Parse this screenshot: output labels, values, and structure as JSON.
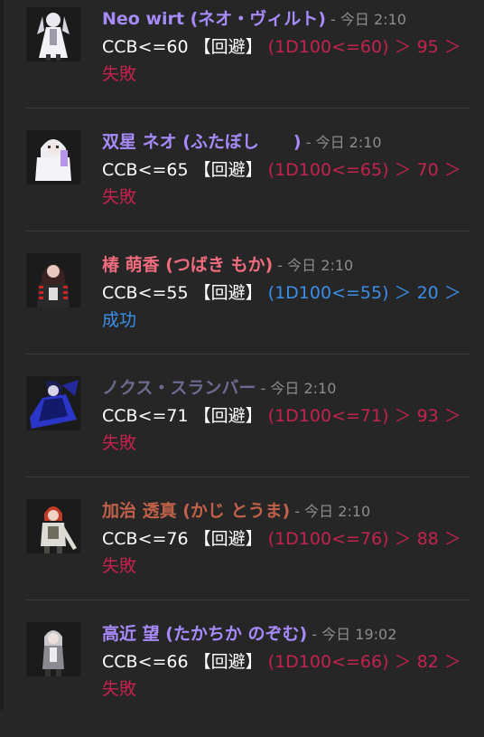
{
  "messages": [
    {
      "name": "Neo wirt (ネオ・ヴィルト)",
      "name_color": "#a78bfa",
      "separator": " - ",
      "time": "今日 2:10",
      "command": "CCB<=60 【回避】 ",
      "result_line1": "(1D100<=60) ＞ 95 ＞",
      "result_line2": "失敗",
      "outcome": "fail",
      "avatar": "white-haired-character-avatar"
    },
    {
      "name": "双星 ネオ (ふたぼし　　)",
      "name_color": "#a78bfa",
      "separator": " - ",
      "time": "今日 2:10",
      "command": "CCB<=65 【回避】 ",
      "result_line1": "(1D100<=65) ＞ 70 ＞",
      "result_line2": "失敗",
      "outcome": "fail",
      "avatar": "hooded-white-character-avatar"
    },
    {
      "name": "椿 萌香 (つばき もか)",
      "name_color": "#f06b7d",
      "separator": " - ",
      "time": "今日 2:10",
      "command": "CCB<=55 【回避】 ",
      "result_line1": "(1D100<=55) ＞ 20 ＞",
      "result_line2": "成功",
      "outcome": "success",
      "avatar": "dark-haired-striped-character-avatar"
    },
    {
      "name": "ノクス・スランバー",
      "name_color": "#6b6b8f",
      "separator": " - ",
      "time": "今日 2:10",
      "command": "CCB<=71 【回避】 ",
      "result_line1": "(1D100<=71) ＞ 93 ＞",
      "result_line2": "失敗",
      "outcome": "fail",
      "avatar": "blue-cloaked-character-avatar"
    },
    {
      "name": "加治 透真 (かじ とうま)",
      "name_color": "#c0614a",
      "separator": " - ",
      "time": "今日 2:10",
      "command": "CCB<=76 【回避】 ",
      "result_line1": "(1D100<=76) ＞ 88 ＞",
      "result_line2": "失敗",
      "outcome": "fail",
      "avatar": "red-haired-character-avatar"
    },
    {
      "name": "高近 望 (たかちか のぞむ)",
      "name_color": "#a78bfa",
      "separator": " - ",
      "time": "今日 19:02",
      "command": "CCB<=66 【回避】 ",
      "result_line1": "(1D100<=66) ＞ 82 ＞",
      "result_line2": "失敗",
      "outcome": "fail",
      "avatar": "grey-haired-character-avatar"
    }
  ],
  "colors": {
    "background": "#262626",
    "fail": "#c4234d",
    "success": "#3b8ee8",
    "timestamp": "#8d8d8d"
  }
}
